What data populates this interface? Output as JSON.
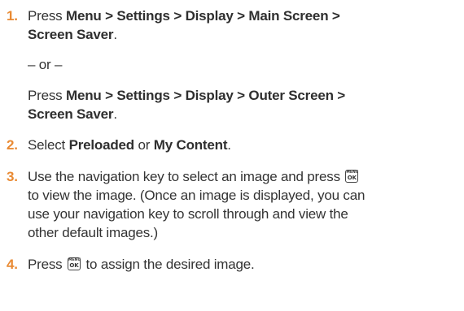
{
  "steps": [
    {
      "number": "1.",
      "prefix": "Press ",
      "path1_line1": "Menu > Settings > Display > Main Screen >",
      "path1_line2": "Screen Saver",
      "path1_end": ".",
      "or": "– or –",
      "path2_prefix": "Press ",
      "path2_line1": "Menu > Settings > Display > Outer Screen >",
      "path2_line2": "Screen Saver",
      "path2_end": "."
    },
    {
      "number": "2.",
      "prefix": "Select ",
      "opt1": "Preloaded",
      "middle": " or ",
      "opt2": "My Content",
      "end": "."
    },
    {
      "number": "3.",
      "line1": "Use the navigation key to select an image and press",
      "line2": "to view the image. (Once an image is displayed, you can",
      "line3": "use your navigation key to scroll through and view the",
      "line4": "other default images.)"
    },
    {
      "number": "4.",
      "prefix": "Press",
      "suffix": "to assign the desired image."
    }
  ],
  "menu_ok_key": {
    "top": "MENU",
    "bottom": "OK",
    "icon": "menu-ok-key-icon"
  }
}
